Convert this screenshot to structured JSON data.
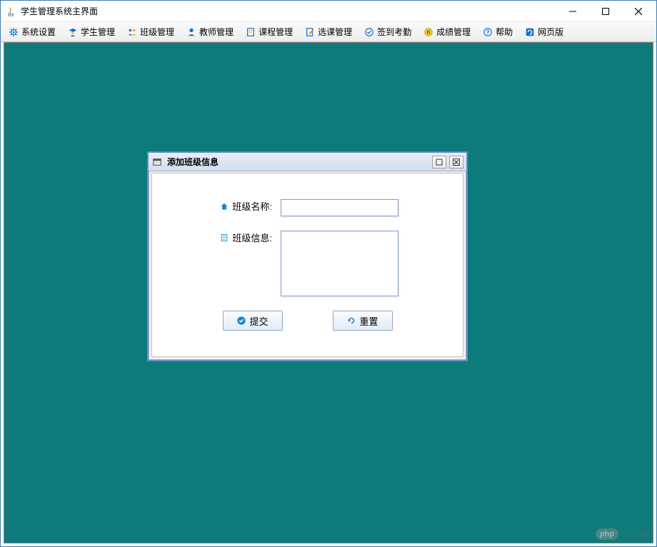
{
  "window": {
    "title": "学生管理系统主界面"
  },
  "toolbar": {
    "items": [
      {
        "label": "系统设置",
        "icon": "gear-icon"
      },
      {
        "label": "学生管理",
        "icon": "student-icon"
      },
      {
        "label": "班级管理",
        "icon": "class-icon"
      },
      {
        "label": "教师管理",
        "icon": "teacher-icon"
      },
      {
        "label": "课程管理",
        "icon": "course-icon"
      },
      {
        "label": "选课管理",
        "icon": "select-course-icon"
      },
      {
        "label": "签到考勤",
        "icon": "attendance-icon"
      },
      {
        "label": "成绩管理",
        "icon": "grade-icon"
      },
      {
        "label": "帮助",
        "icon": "help-icon"
      },
      {
        "label": "网页版",
        "icon": "web-icon"
      }
    ]
  },
  "dialog": {
    "title": "添加班级信息",
    "fields": {
      "class_name": {
        "label": "班级名称:",
        "value": ""
      },
      "class_info": {
        "label": "班级信息:",
        "value": ""
      }
    },
    "buttons": {
      "submit": "提交",
      "reset": "重置"
    }
  },
  "watermark": {
    "badge": "php",
    "text": "中文网"
  }
}
